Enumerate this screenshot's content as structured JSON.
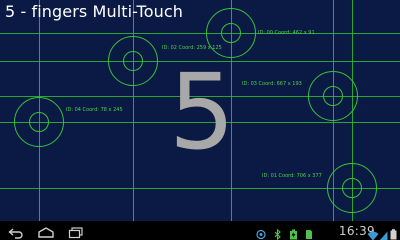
{
  "app": {
    "title": "5 - fingers Multi-Touch",
    "finger_count": "5"
  },
  "touches": [
    {
      "label": "ID: 00 Coord: 462 x 91"
    },
    {
      "label": "ID: 02 Coord: 259 x 125"
    },
    {
      "label": "ID: 03 Coord: 667 x 193"
    },
    {
      "label": "ID: 04 Coord: 78 x 245"
    },
    {
      "label": "ID: 01 Coord: 706 x 377"
    }
  ],
  "status_bar": {
    "time": "16:39",
    "icons": [
      "usb-debug-icon",
      "bluetooth-icon",
      "battery-saver-icon",
      "storage-icon",
      "wifi-icon",
      "signal-icon",
      "battery-icon"
    ]
  },
  "navigation": {
    "buttons": [
      "back-icon",
      "home-icon",
      "recent-apps-icon"
    ]
  },
  "colors": {
    "background": "#0b1a45",
    "grid_lines": "#2fbf2f",
    "title_text": "#ffffff",
    "count_text": "#a8a8a8",
    "nav_bar": "#000000"
  }
}
